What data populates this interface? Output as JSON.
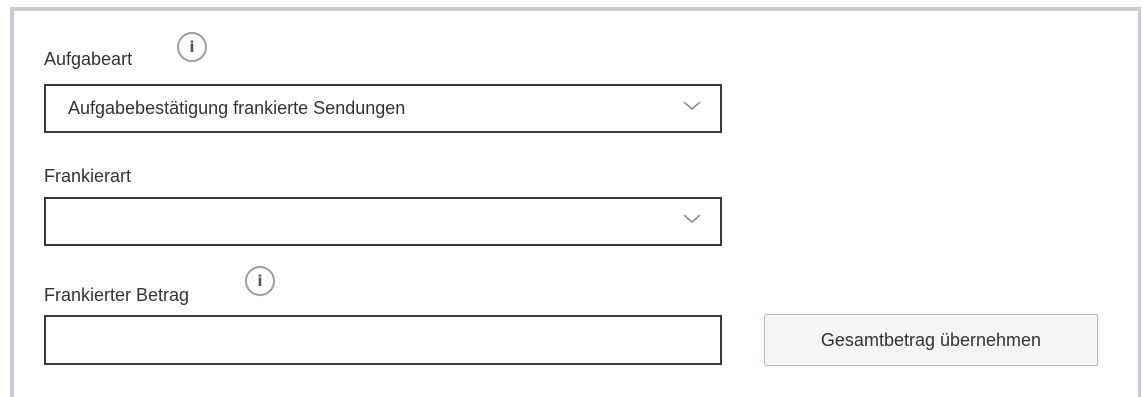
{
  "aufgabeart": {
    "label": "Aufgabeart",
    "info_icon": "i",
    "selected_value": "Aufgabebestätigung frankierte Sendungen"
  },
  "frankierart": {
    "label": "Frankierart",
    "selected_value": ""
  },
  "frankierter_betrag": {
    "label": "Frankierter Betrag",
    "info_icon": "i",
    "value": "",
    "button_label": "Gesamtbetrag übernehmen"
  },
  "icons": {
    "info": "info-icon",
    "dropdown": "chevron-down-icon"
  },
  "colors": {
    "panel_border": "#c8ccd6",
    "field_border": "#3a3a3a",
    "text": "#333333",
    "button_bg": "#f4f5f6"
  }
}
